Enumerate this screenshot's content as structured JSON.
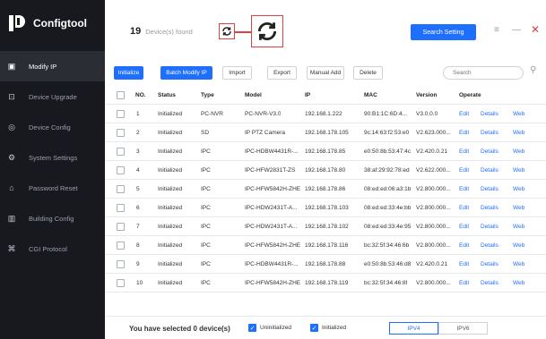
{
  "app": {
    "name": "Configtool"
  },
  "sidebar": {
    "items": [
      {
        "label": "Modify IP",
        "icon": "modify-ip-icon",
        "glyph": "▣",
        "active": true
      },
      {
        "label": "Device Upgrade",
        "icon": "upgrade-icon",
        "glyph": "⊡",
        "active": false
      },
      {
        "label": "Device Config",
        "icon": "device-config-icon",
        "glyph": "◎",
        "active": false
      },
      {
        "label": "System Settings",
        "icon": "settings-icon",
        "glyph": "⚙",
        "active": false
      },
      {
        "label": "Password Reset",
        "icon": "lock-icon",
        "glyph": "⌂",
        "active": false
      },
      {
        "label": "Building Config",
        "icon": "building-icon",
        "glyph": "▥",
        "active": false
      },
      {
        "label": "CGI Protocol",
        "icon": "cgi-icon",
        "glyph": "⌘",
        "active": false
      }
    ]
  },
  "topbar": {
    "found_count": "19",
    "found_label": "Device(s) found",
    "search_setting": "Search Setting"
  },
  "toolbar": {
    "initialize": "Initialize",
    "batch_modify": "Batch Modify IP",
    "import": "Import",
    "export": "Export",
    "manual_add": "Manual Add",
    "delete": "Delete",
    "search_placeholder": "Search"
  },
  "table": {
    "headers": {
      "no": "NO.",
      "status": "Status",
      "type": "Type",
      "model": "Model",
      "ip": "IP",
      "mac": "MAC",
      "version": "Version",
      "operate": "Operate"
    },
    "actions": {
      "edit": "Edit",
      "details": "Details",
      "web": "Web"
    },
    "rows": [
      {
        "no": "1",
        "status": "Initialized",
        "type": "PC-NVR",
        "model": "PC-NVR-V3.0",
        "ip": "192.168.1.222",
        "mac": "90:B1:1C:6D:4...",
        "version": "V3.0.0.0"
      },
      {
        "no": "2",
        "status": "Initialized",
        "type": "SD",
        "model": "IP PTZ Camera",
        "ip": "192.168.178.105",
        "mac": "9c:14:63:f2:53:e0",
        "version": "V2.623.000..."
      },
      {
        "no": "3",
        "status": "Initialized",
        "type": "IPC",
        "model": "IPC-HDBW4431R-...",
        "ip": "192.168.178.85",
        "mac": "e0:50:8b:53:47:4c",
        "version": "V2.420.0.21"
      },
      {
        "no": "4",
        "status": "Initialized",
        "type": "IPC",
        "model": "IPC-HFW2831T-ZS",
        "ip": "192.168.178.80",
        "mac": "38:af:29:92:78:ed",
        "version": "V2.622.000..."
      },
      {
        "no": "5",
        "status": "Initialized",
        "type": "IPC",
        "model": "IPC-HFW5842H-ZHE",
        "ip": "192.168.178.86",
        "mac": "08:ed:ed:06:a3:1b",
        "version": "V2.800.000..."
      },
      {
        "no": "6",
        "status": "Initialized",
        "type": "IPC",
        "model": "IPC-HDW2431T-A...",
        "ip": "192.168.178.103",
        "mac": "08:ed:ed:33:4e:bb",
        "version": "V2.800.000..."
      },
      {
        "no": "7",
        "status": "Initialized",
        "type": "IPC",
        "model": "IPC-HDW2431T-A...",
        "ip": "192.168.178.102",
        "mac": "08:ed:ed:33:4e:95",
        "version": "V2.800.000..."
      },
      {
        "no": "8",
        "status": "Initialized",
        "type": "IPC",
        "model": "IPC-HFW5842H-ZHE",
        "ip": "192.168.178.116",
        "mac": "bc:32:5f:34:46:6b",
        "version": "V2.800.000..."
      },
      {
        "no": "9",
        "status": "Initialized",
        "type": "IPC",
        "model": "IPC-HDBW4431R-...",
        "ip": "192.168.178.88",
        "mac": "e0:50:8b:53:46:d8",
        "version": "V2.420.0.21"
      },
      {
        "no": "10",
        "status": "Initialized",
        "type": "IPC",
        "model": "IPC-HFW5842H-ZHE",
        "ip": "192.168.178.119",
        "mac": "bc:32:5f:34:46:8f",
        "version": "V2.800.000..."
      }
    ]
  },
  "footer": {
    "selected_text": "You have selected 0 device(s)",
    "uninitialized": "Uninitialized",
    "initialized": "Initialized",
    "ipv4": "IPV4",
    "ipv6": "IPV6"
  },
  "colors": {
    "accent": "#1f6fff",
    "sidebar": "#17191e",
    "highlight": "#e04040"
  }
}
